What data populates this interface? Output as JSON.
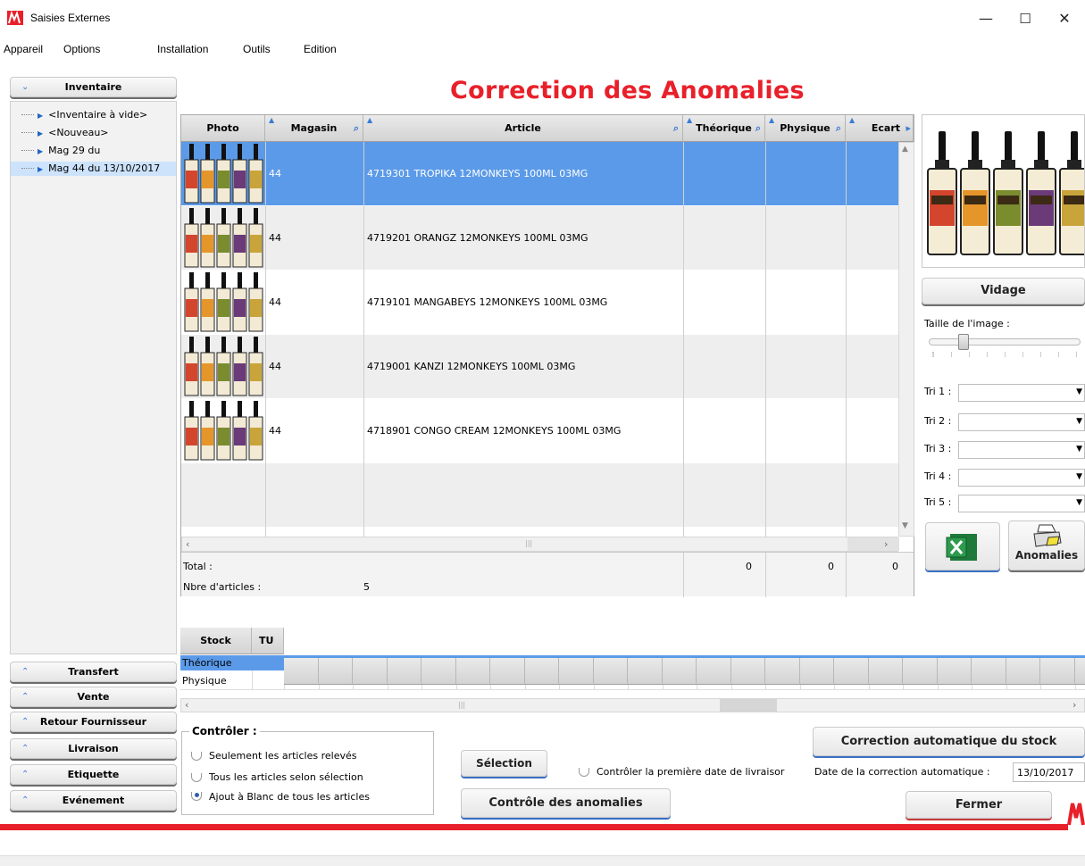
{
  "window": {
    "title": "Saisies Externes",
    "minimize_glyph": "—",
    "maximize_glyph": "☐",
    "close_glyph": "✕"
  },
  "menu": [
    "Appareil",
    "Options",
    "Installation",
    "Outils",
    "Edition"
  ],
  "left_panel": {
    "top_section": "Inventaire",
    "tree_items": [
      {
        "label": "<Inventaire à vide>"
      },
      {
        "label": "<Nouveau>"
      },
      {
        "label": "Mag 29 du"
      },
      {
        "label": "Mag 44 du 13/10/2017"
      }
    ],
    "bottom_sections": [
      "Transfert",
      "Vente",
      "Retour Fournisseur",
      "Livraison",
      "Etiquette",
      "Evénement"
    ]
  },
  "heading": "Correction des Anomalies",
  "grid": {
    "columns": [
      "Photo",
      "Magasin",
      "Article",
      "Théorique",
      "Physique",
      "Ecart"
    ],
    "rows": [
      {
        "magasin": "44",
        "article": "4719301 TROPIKA 12MONKEYS 100ML 03MG"
      },
      {
        "magasin": "44",
        "article": "4719201 ORANGZ 12MONKEYS 100ML 03MG"
      },
      {
        "magasin": "44",
        "article": "4719101 MANGABEYS 12MONKEYS 100ML 03MG"
      },
      {
        "magasin": "44",
        "article": "4719001 KANZI 12MONKEYS 100ML 03MG"
      },
      {
        "magasin": "44",
        "article": "4718901 CONGO CREAM 12MONKEYS 100ML 03MG"
      }
    ],
    "selected_row": 0,
    "footer": {
      "total_label": "Total :",
      "total_theorique": "0",
      "total_physique": "0",
      "total_ecart": "0",
      "count_label": "Nbre d'articles :",
      "count_value": "5"
    }
  },
  "right_panel": {
    "vidage_button": "Vidage",
    "image_size_label": "Taille de l'image :",
    "image_size_level": 0.2,
    "sorts": [
      "Tri 1 :",
      "Tri 2 :",
      "Tri 3 :",
      "Tri 4 :",
      "Tri 5 :"
    ],
    "excel_icon": "excel-icon",
    "anomalies_button": "Anomalies"
  },
  "stock_grid": {
    "columns": [
      "Stock",
      "TU"
    ],
    "rows": [
      "Théorique",
      "Physique"
    ],
    "selected_row": 0
  },
  "controller": {
    "legend": "Contrôler :",
    "options": [
      {
        "label": "Seulement les articles relevés",
        "selected": false
      },
      {
        "label": "Tous les articles selon sélection",
        "selected": false
      },
      {
        "label": "Ajout à Blanc de tous les articles",
        "selected": true
      }
    ]
  },
  "buttons": {
    "selection": "Sélection",
    "anomaly_check": "Contrôle des anomalies",
    "auto_correction": "Correction automatique du stock",
    "close": "Fermer"
  },
  "first_delivery_check": {
    "label": "Contrôler la première date de livraisor",
    "checked": false
  },
  "auto_correction_date": {
    "label": "Date de la correction automatique :",
    "value": "13/10/2017"
  },
  "colors": {
    "accent_red": "#e8202a",
    "selection_blue": "#5b9ae8"
  }
}
